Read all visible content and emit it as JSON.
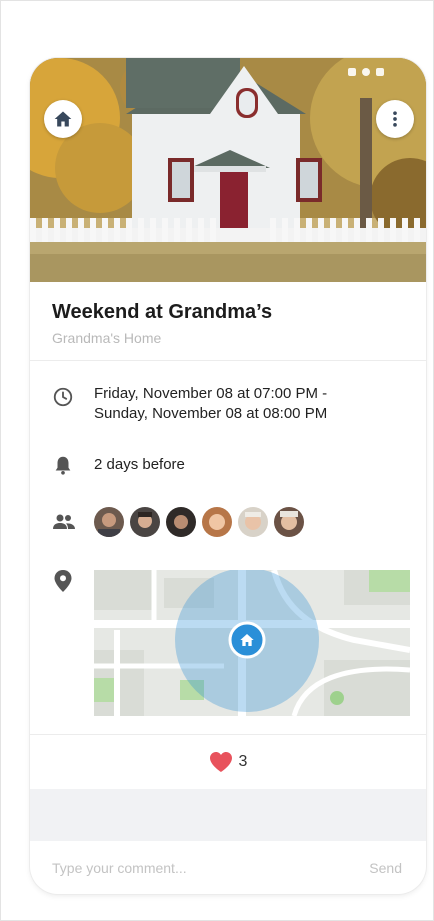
{
  "event": {
    "title": "Weekend at Grandma’s",
    "location_name": "Grandma's Home",
    "date_line_1": "Friday, November 08 at 07:00 PM -",
    "date_line_2": "Sunday, November 08 at 08:00 PM",
    "reminder": "2 days before"
  },
  "icons": {
    "home": "home-icon",
    "more": "more-vertical-icon",
    "clock": "clock-icon",
    "bell": "bell-icon",
    "people": "people-icon",
    "pin": "location-pin-icon",
    "heart": "heart-icon",
    "map_marker": "home-marker-icon"
  },
  "attendees": [
    {
      "name": "guest-1"
    },
    {
      "name": "guest-2"
    },
    {
      "name": "guest-3"
    },
    {
      "name": "guest-4"
    },
    {
      "name": "guest-5"
    },
    {
      "name": "guest-6"
    }
  ],
  "likes": {
    "count": "3"
  },
  "comment": {
    "placeholder": "Type your comment...",
    "send_label": "Send"
  },
  "colors": {
    "accent": "#2a8fd8",
    "heart": "#e8525c",
    "muted_text": "#b9b9b9"
  }
}
